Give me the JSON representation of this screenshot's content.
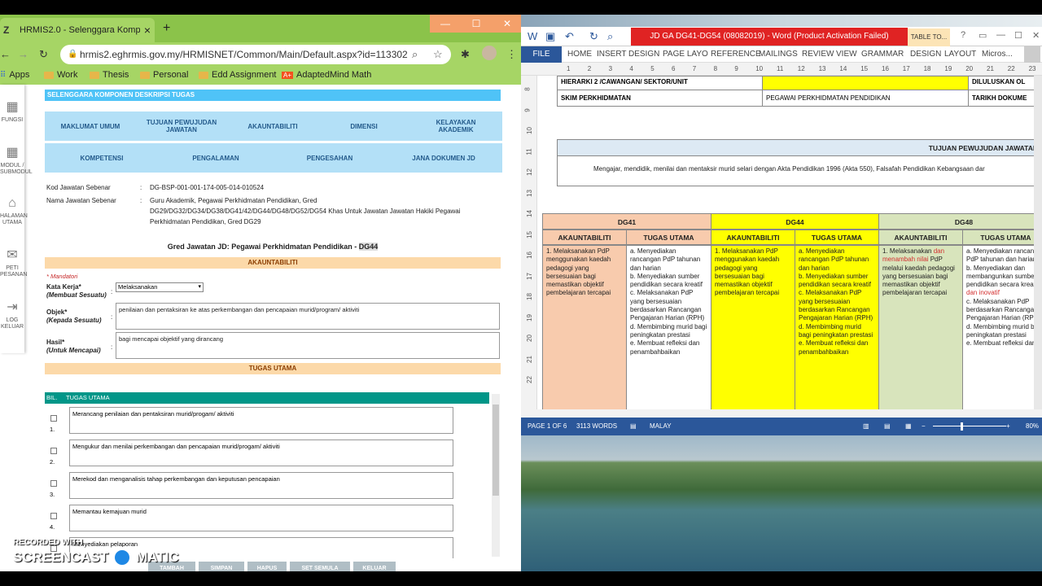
{
  "chrome": {
    "tab_title": "HRMIS2.0 - Selenggara Kompon",
    "favicon": "Z",
    "url": "hrmis2.eghrmis.gov.my/HRMISNET/Common/Main/Default.aspx?id=113302",
    "bookmarks": [
      "Apps",
      "Work",
      "Thesis",
      "Personal",
      "Edd Assignment",
      "AdaptedMind Math"
    ]
  },
  "sidebar": [
    {
      "icon": "grid-icon",
      "label": "FUNGSI"
    },
    {
      "icon": "modules-icon",
      "label": "MODUL / SUBMODUL"
    },
    {
      "icon": "home-icon",
      "label": "HALAMAN UTAMA"
    },
    {
      "icon": "mail-icon",
      "label": "PETI PESANAN"
    },
    {
      "icon": "logout-icon",
      "label": "LOG KELUAR"
    }
  ],
  "form": {
    "header": "SELENGGARA KOMPONEN DESKRIPSI TUGAS",
    "menu_row1": [
      "MAKLUMAT UMUM",
      "TUJUAN PEWUJUDAN JAWATAN",
      "AKAUNTABILITI",
      "DIMENSI",
      "KELAYAKAN AKADEMIK"
    ],
    "menu_row2": [
      "KOMPETENSI",
      "PENGALAMAN",
      "PENGESAHAN",
      "JANA DOKUMEN JD"
    ],
    "kod_label": "Kod Jawatan Sebenar",
    "kod_value": "DG-BSP-001-001-174-005-014-010524",
    "nama_label": "Nama Jawatan Sebenar",
    "nama_value": "Guru Akademik, Pegawai Perkhidmatan Pendidikan, Gred DG29/DG32/DG34/DG38/DG41/42/DG44/DG48/DG52/DG54 Khas Untuk Jawatan Jawatan Hakiki Pegawai Perkhidmatan Pendidikan, Gred DG29",
    "gred_title": "Gred Jawatan JD: Pegawai Perkhidmatan Pendidikan - ",
    "gred_code": "DG44",
    "akauntabiliti_header": "AKAUNTABILITI",
    "mandatori": "* Mandatori",
    "kata_kerja_label": "Kata Kerja*",
    "kata_kerja_sub": "(Membuat Sesuatu)",
    "kata_kerja_value": "Melaksanakan",
    "objek_label": "Objek*",
    "objek_sub": "(Kepada Sesuatu)",
    "objek_value": "penilaian dan pentaksiran ke atas perkembangan dan pencapaian murid/program/ aktiviti",
    "hasil_label": "Hasil*",
    "hasil_sub": "(Untuk Mencapai)",
    "hasil_value": "bagi mencapai objektif yang dirancang",
    "tugas_header": "TUGAS UTAMA",
    "col_bil": "BIL.",
    "col_tugas": "TUGAS UTAMA",
    "tasks": [
      {
        "num": "1.",
        "text": "Merancang penilaian dan pentaksiran murid/progam/ aktiviti"
      },
      {
        "num": "2.",
        "text": "Mengukur dan menilai perkembangan dan pencapaian murid/progam/ aktiviti"
      },
      {
        "num": "3.",
        "text": "Merekod dan menganalisis tahap perkembangan dan keputusan pencapaian"
      },
      {
        "num": "4.",
        "text": "Memantau kemajuan murid"
      },
      {
        "num": "5.",
        "text": "Menyediakan pelaporan"
      }
    ],
    "buttons": [
      "TAMBAH",
      "SIMPAN",
      "HAPUS",
      "SET SEMULA",
      "KELUAR"
    ]
  },
  "watermark": {
    "line1": "RECORDED WITH",
    "line2a": "SCREENCAST",
    "line2b": "MATIC"
  },
  "word": {
    "doc_title": "JD GA DG41-DG54 (08082019) - Word (Product Activation Failed)",
    "table_tools": "TABLE TO...",
    "ribbon": [
      "FILE",
      "HOME",
      "INSERT",
      "DESIGN",
      "PAGE LAYO",
      "REFERENCE",
      "MAILINGS",
      "REVIEW",
      "VIEW",
      "GRAMMAR",
      "DESIGN",
      "LAYOUT"
    ],
    "user": "Micros...",
    "ruler_ticks": [
      "1",
      "2",
      "3",
      "4",
      "5",
      "6",
      "7",
      "8",
      "9",
      "10",
      "11",
      "12",
      "13",
      "14",
      "15",
      "16",
      "17",
      "18",
      "19",
      "20",
      "21",
      "22",
      "23"
    ],
    "vruler_ticks": [
      "8",
      "9",
      "10",
      "11",
      "12",
      "13",
      "14",
      "15",
      "16",
      "17",
      "18",
      "19",
      "20",
      "21",
      "22"
    ],
    "hierarki_label": "HIERARKI 2 /CAWANGAN/ SEKTOR/UNIT",
    "diluluskan": "DILULUSKAN OL",
    "skim_label": "SKIM PERKHIDMATAN",
    "skim_value": "PEGAWAI PERKHIDMATAN PENDIDIKAN",
    "tarikh": "TARIKH DOKUME",
    "tujuan_header": "TUJUAN PEWUJUDAN JAWATAN",
    "tujuan_text": "Mengajar, mendidik, menilai dan mentaksir murid selari dengan Akta Pendidikan 1996 (Akta 550), Falsafah Pendidikan Kebangsaan dar",
    "grades": [
      {
        "name": "DG41",
        "color": "#f8cbad"
      },
      {
        "name": "DG44",
        "color": "#ffff00"
      },
      {
        "name": "DG48",
        "color": "#d8e4bc"
      }
    ],
    "sub_akaun": "AKAUNTABILITI",
    "sub_tugas": "TUGAS UTAMA",
    "dg41_akaun": "1.      Melaksanakan PdP menggunakan kaedah pedagogi yang bersesuaian bagi memastikan objektif pembelajaran tercapai",
    "dg41_tugas": "a.      Menyediakan rancangan PdP tahunan dan harian\nb.      Menyediakan sumber pendidikan secara kreatif\nc.      Melaksanakan PdP yang bersesuaian berdasarkan Rancangan Pengajaran Harian (RPH)\nd.      Membimbing murid bagi peningkatan prestasi\ne.      Membuat refleksi dan penambahbaikan",
    "dg44_akaun": "1.      Melaksanakan PdP menggunakan kaedah pedagogi yang bersesuaian bagi memastikan objektif pembelajaran tercapai",
    "dg44_tugas": "a.      Menyediakan rancangan PdP tahunan dan harian\nb.      Menyediakan sumber pendidikan secara kreatif\nc.      Melaksanakan PdP yang bersesuaian berdasarkan Rancangan Pengajaran Harian (RPH)\nd.      Membimbing murid bagi peningkatan prestasi\ne.      Membuat refleksi dan penambahbaikan",
    "dg48_akaun_1": "1.      Melaksanakan ",
    "dg48_akaun_red": "dan menambah nilai",
    "dg48_akaun_2": " PdP melalui kaedah pedagogi yang bersesuaian bagi memastikan objektif pembelajaran tercapai",
    "dg48_tugas_1": "a.      Menyediakan rancangan PdP tahunan dan harian\nb.      Menyediakan dan membangunkan sumber pendidikan secara kreatif ",
    "dg48_tugas_red": "dan inovatif",
    "dg48_tugas_2": "\nc.      Melaksanakan PdP berdasarkan Rancangan Pengajaran Harian (RPH)\nd.      Membimbing murid bagi peningkatan prestasi\ne.      Membuat refleksi dan",
    "status_page": "PAGE 1 OF 6",
    "status_words": "3113 WORDS",
    "status_lang": "MALAY",
    "zoom": "80%"
  }
}
